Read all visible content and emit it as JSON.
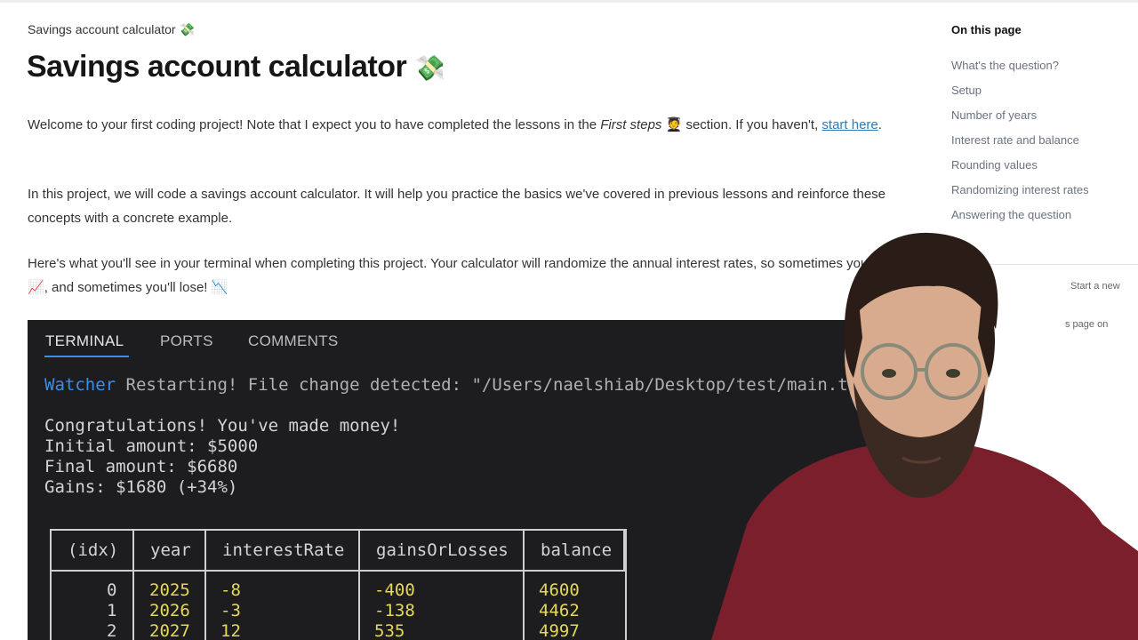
{
  "breadcrumb": {
    "text": "Savings account calculator",
    "emoji": "💸"
  },
  "title": {
    "text": "Savings account calculator",
    "emoji": "💸"
  },
  "intro": {
    "p1_before": "Welcome to your first coding project! Note that I expect you to have completed the lessons in the ",
    "p1_italic": "First steps",
    "p1_emoji": "🧑‍🎓",
    "p1_after": " section. If you haven't, ",
    "p1_link": "start here",
    "p1_end": ".",
    "p2": "In this project, we will code a savings account calculator. It will help you practice the basics we've covered in previous lessons and reinforce these concepts with a concrete example.",
    "p3_before": "Here's what you'll see in your terminal when completing this project. Your calculator will randomize the annual interest rates, so sometimes you'll win ",
    "p3_emoji1": "📈",
    "p3_mid": ", and sometimes you'll lose! ",
    "p3_emoji2": "📉"
  },
  "toc": {
    "title": "On this page",
    "items": [
      "What's the question?",
      "Setup",
      "Number of years",
      "Interest rate and balance",
      "Rounding values",
      "Randomizing interest rates",
      "Answering the question"
    ],
    "extra1": "Start a new",
    "extra2": "s page on"
  },
  "terminal": {
    "tabs": [
      "TERMINAL",
      "PORTS",
      "COMMENTS"
    ],
    "watcher_label": "Watcher",
    "watcher_msg": " Restarting! File change detected: \"/Users/naelshiab/Desktop/test/main.ts",
    "line1": "Congratulations! You've made money!",
    "line2": "Initial amount: $5000",
    "line3": "Final amount: $6680",
    "line4": "Gains: $1680 (+34%)",
    "table": {
      "headers": [
        "(idx)",
        "year",
        "interestRate",
        "gainsOrLosses",
        "balance"
      ],
      "rows": [
        [
          "0",
          "2025",
          "-8",
          "-400",
          "4600"
        ],
        [
          "1",
          "2026",
          "-3",
          "-138",
          "4462"
        ],
        [
          "2",
          "2027",
          "12",
          "535",
          "4997"
        ]
      ]
    }
  },
  "colors": {
    "link": "#2f7cb8",
    "terminal_bg": "#1d1d1f",
    "watcher": "#3b8eea",
    "values": "#e5d85c"
  }
}
